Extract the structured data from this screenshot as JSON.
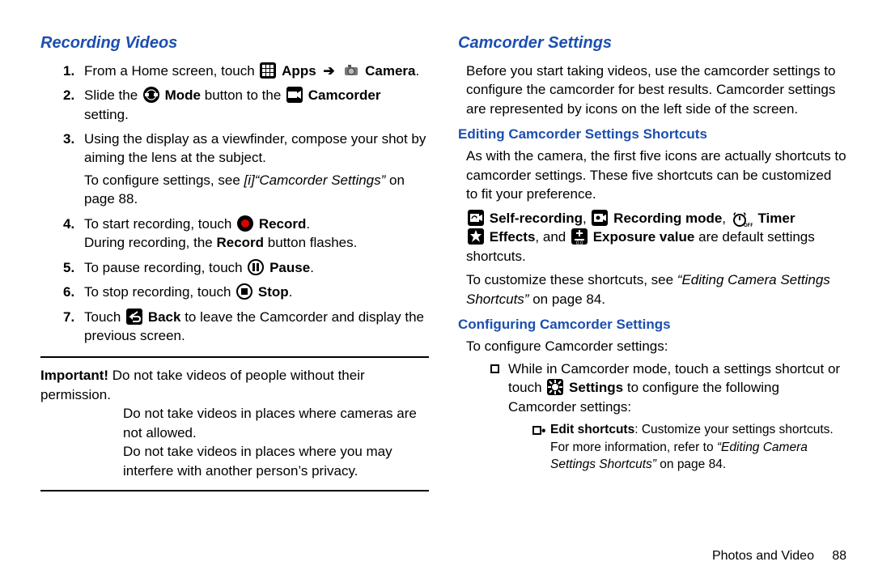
{
  "left": {
    "heading": "Recording Videos",
    "steps": [
      {
        "parts": [
          "From a Home screen, touch ",
          "[apps-icon]",
          " ",
          "[b]Apps",
          " ",
          "[arrow]",
          " ",
          "[camera-icon]",
          " ",
          "[b]Camera",
          "."
        ]
      },
      {
        "parts": [
          "Slide the ",
          "[mode-icon]",
          " ",
          "[b]Mode",
          " button to the ",
          "[camcorder-icon]",
          " ",
          "[b]Camcorder",
          " setting."
        ]
      },
      {
        "parts": [
          "Using the display as a viewfinder, compose your shot by aiming the lens at the subject."
        ],
        "after": [
          "To configure settings, see ",
          "[i]“Camcorder Settings”",
          " on page 88."
        ]
      },
      {
        "parts": [
          "To start recording, touch ",
          "[record-icon]",
          " ",
          "[b]Record",
          "."
        ],
        "after": [
          "During recording, the ",
          "[b]Record",
          " button flashes."
        ]
      },
      {
        "parts": [
          "To pause recording, touch ",
          "[pause-icon]",
          " ",
          "[b]Pause",
          "."
        ]
      },
      {
        "parts": [
          "To stop recording, touch ",
          "[stop-icon]",
          " ",
          "[b]Stop",
          "."
        ]
      },
      {
        "parts": [
          "Touch ",
          "[back-icon]",
          " ",
          "[b]Back",
          " to leave the Camcorder and display the previous screen."
        ]
      }
    ],
    "important_label": "Important!",
    "important": [
      "Do not take videos of people without their permission.",
      "Do not take videos in places where cameras are not allowed.",
      "Do not take videos in places where you may interfere with another person’s privacy."
    ]
  },
  "right": {
    "heading": "Camcorder Settings",
    "intro": "Before you start taking videos, use the camcorder settings to configure the camcorder for best results. Camcorder settings are represented by icons on the left side of the screen.",
    "sub1": "Editing Camcorder Settings Shortcuts",
    "sub1_p1": "As with the camera, the first five icons are actually shortcuts to camcorder settings. These five shortcuts can be customized to fit your preference.",
    "shortcuts": {
      "self": "Self-recording",
      "mode": "Recording mode",
      "timer": "Timer",
      "effects": "Effects",
      "exposure": "Exposure value",
      "tail": " are default settings shortcuts."
    },
    "sub1_p2_pre": "To customize these shortcuts, see ",
    "sub1_p2_ital": "“Editing Camera Settings Shortcuts”",
    "sub1_p2_post": " on page 84.",
    "sub2": "Configuring Camcorder Settings",
    "sub2_p1": "To configure Camcorder settings:",
    "bullet1_pre": "While in Camcorder mode, touch a settings shortcut or touch ",
    "bullet1_settings": "Settings",
    "bullet1_post": " to configure the following Camcorder settings:",
    "subbullet_label": "Edit shortcuts",
    "subbullet_mid": ": Customize your settings shortcuts. For more information, refer to ",
    "subbullet_ital": "“Editing Camera Settings Shortcuts” ",
    "subbullet_post": "on page 84."
  },
  "footer": {
    "section": "Photos and Video",
    "page": "88"
  }
}
